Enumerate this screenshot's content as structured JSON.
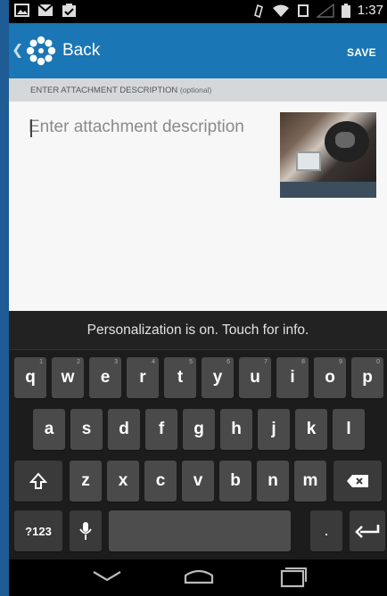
{
  "status_bar": {
    "time": "1:37",
    "left_icons": [
      "image-icon",
      "mail-icon",
      "clipboard-check-icon"
    ],
    "right_icons": [
      "alarm-icon",
      "wifi-icon",
      "sim-icon",
      "signal-icon",
      "battery-icon"
    ]
  },
  "app_bar": {
    "back_label": "Back",
    "save_label": "SAVE",
    "logo_icon": "flower-logo-icon"
  },
  "section_header": {
    "label": "ENTER ATTACHMENT DESCRIPTION",
    "optional": "(optional)"
  },
  "content": {
    "description_placeholder": "Enter attachment description",
    "description_value": ""
  },
  "keyboard": {
    "suggestion": "Personalization is on. Touch for info.",
    "row1": [
      {
        "key": "q",
        "hint": "1"
      },
      {
        "key": "w",
        "hint": "2"
      },
      {
        "key": "e",
        "hint": "3"
      },
      {
        "key": "r",
        "hint": "4"
      },
      {
        "key": "t",
        "hint": "5"
      },
      {
        "key": "y",
        "hint": "6"
      },
      {
        "key": "u",
        "hint": "7"
      },
      {
        "key": "i",
        "hint": "8"
      },
      {
        "key": "o",
        "hint": "9"
      },
      {
        "key": "p",
        "hint": "0"
      }
    ],
    "row2": [
      "a",
      "s",
      "d",
      "f",
      "g",
      "h",
      "j",
      "k",
      "l"
    ],
    "row3": [
      "z",
      "x",
      "c",
      "v",
      "b",
      "n",
      "m"
    ],
    "symbols_label": "?123",
    "period_label": ".",
    "shift_icon": "shift-icon",
    "backspace_icon": "backspace-icon",
    "mic_icon": "mic-icon",
    "enter_icon": "enter-icon"
  },
  "nav_bar": {
    "icons": [
      "back-nav-icon",
      "home-nav-icon",
      "recents-nav-icon"
    ]
  },
  "colors": {
    "app_bar": "#1a76b4",
    "frame": "#1f5b94",
    "keyboard": "#1c1c1c",
    "key": "#4a4a4a"
  }
}
